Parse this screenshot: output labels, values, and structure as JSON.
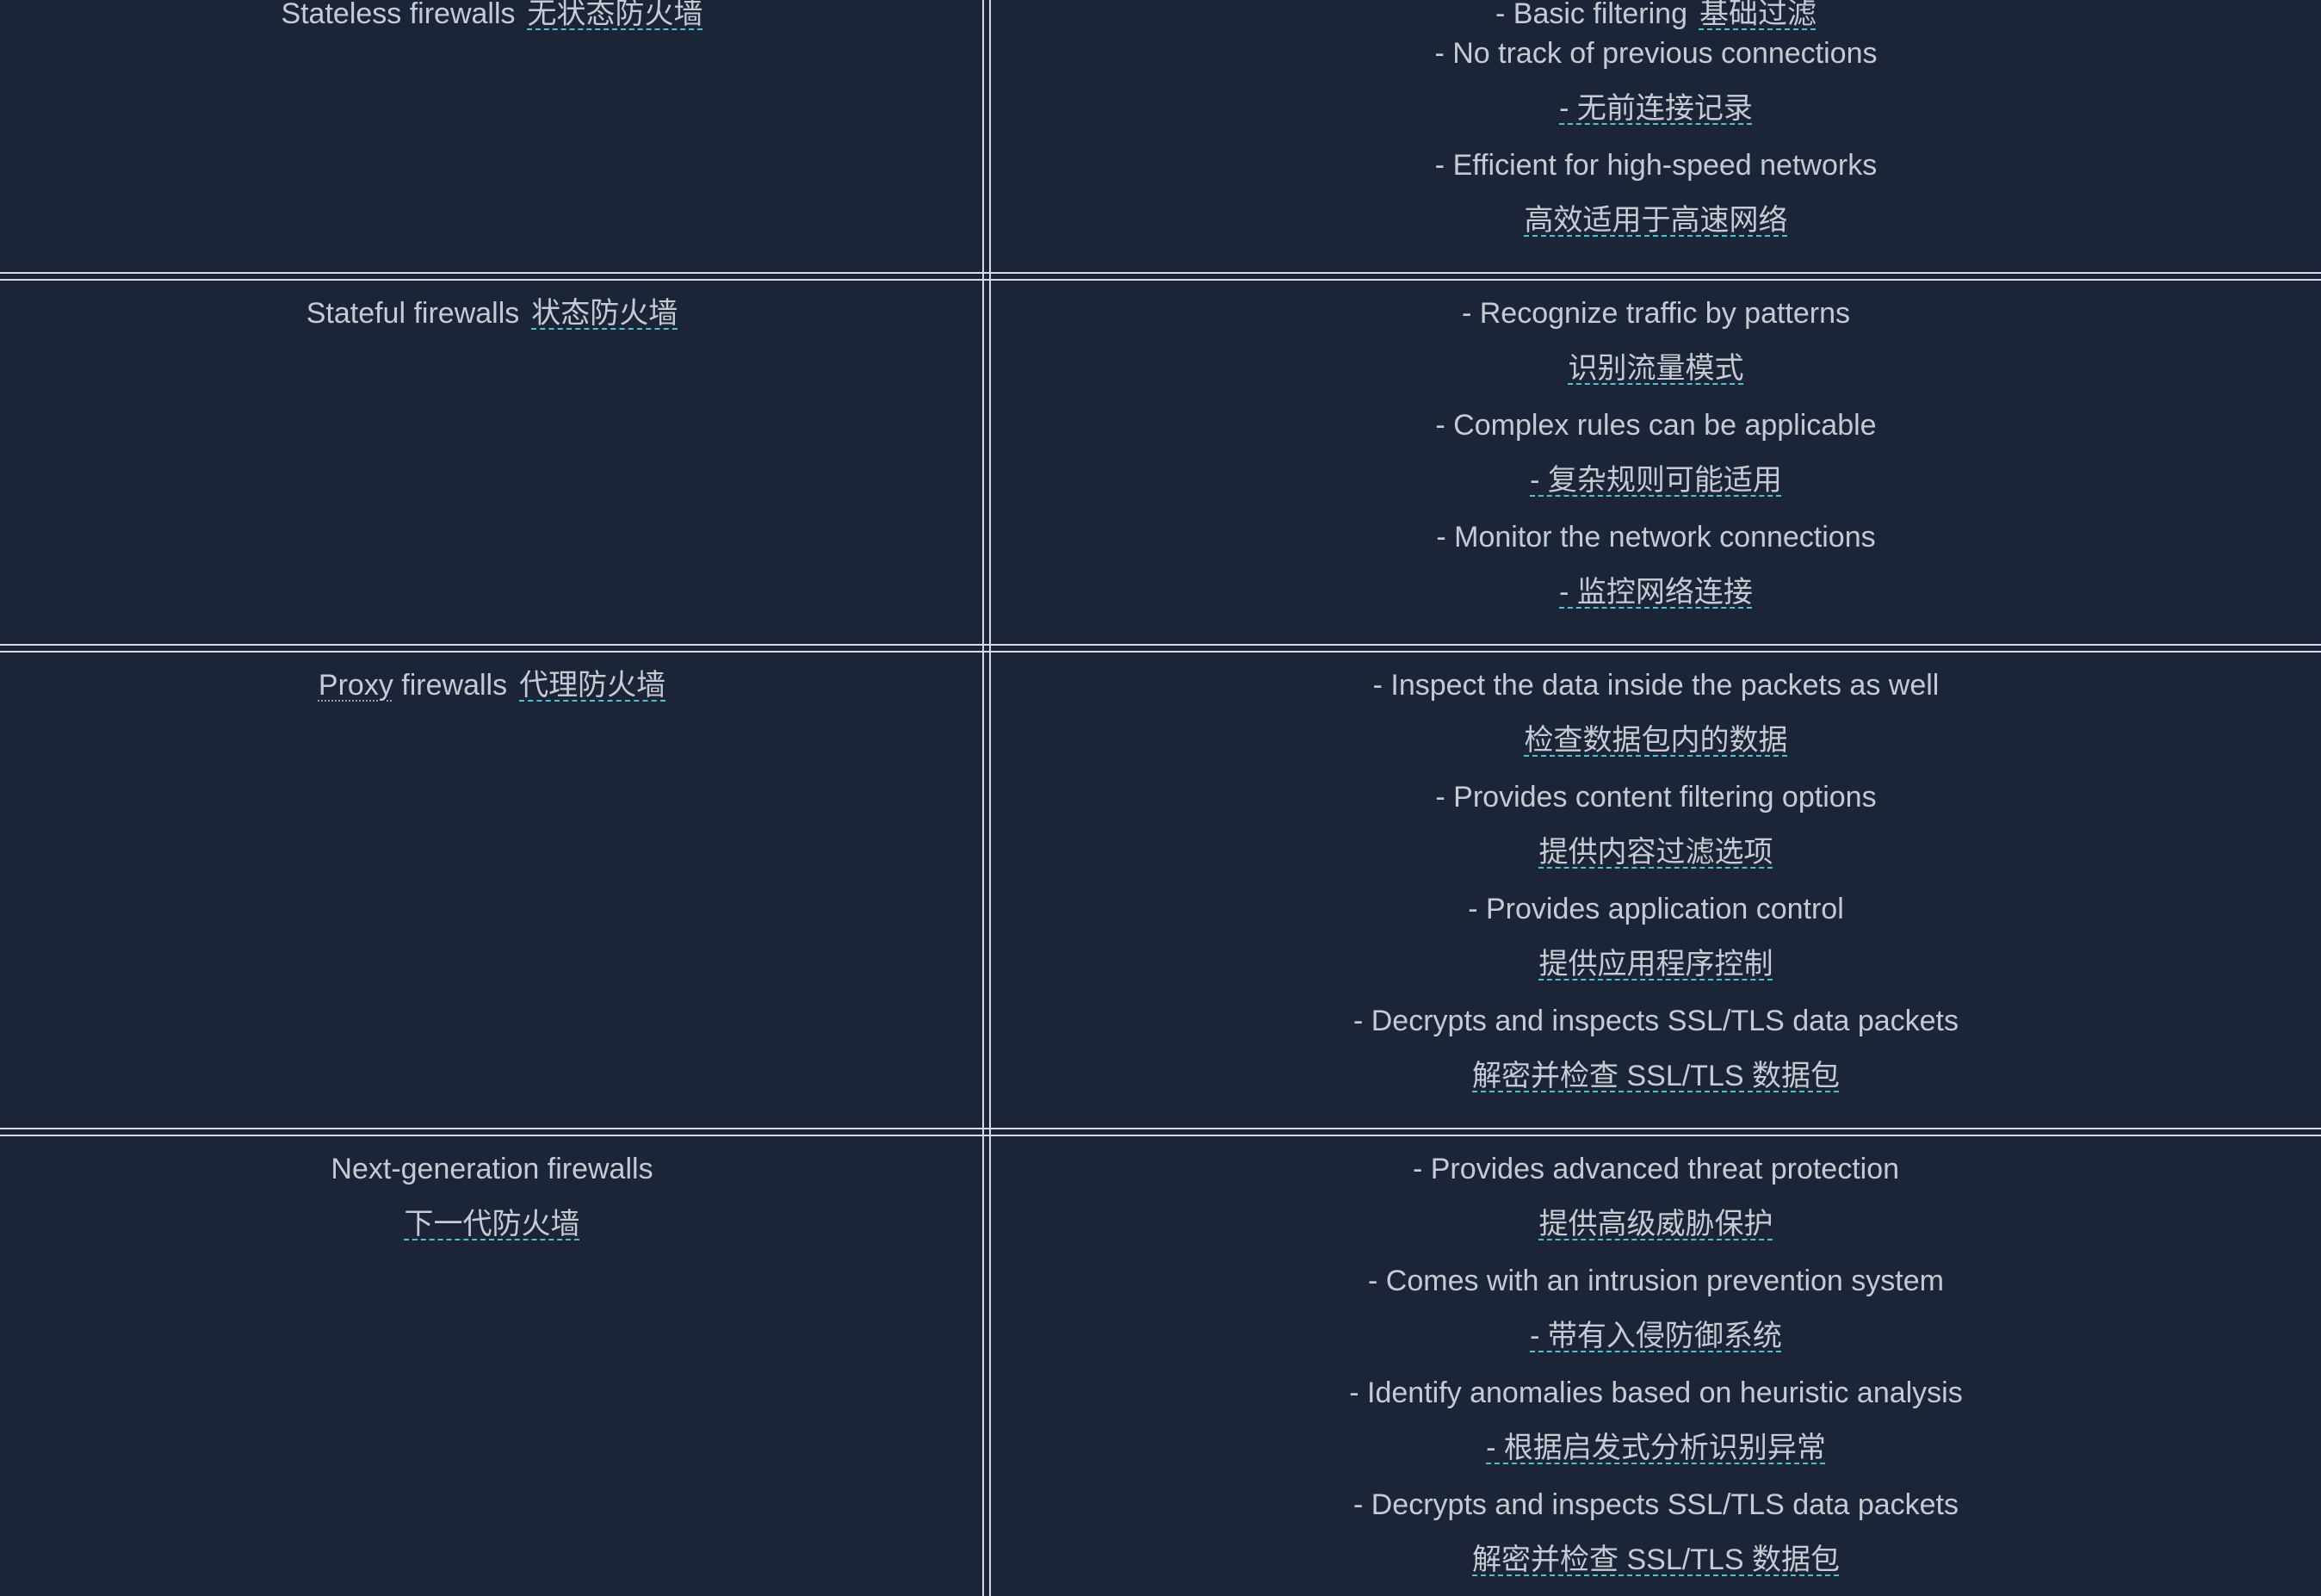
{
  "rows": [
    {
      "name_en": "Stateless firewalls",
      "name_zh": "无状态防火墙",
      "items": [
        {
          "en": "- Basic filtering",
          "zh": "基础过滤"
        },
        {
          "en": "- No track of previous connections",
          "zh": "- 无前连接记录"
        },
        {
          "en": "- Efficient for high-speed networks",
          "zh": "高效适用于高速网络"
        }
      ]
    },
    {
      "name_en": "Stateful firewalls",
      "name_zh": "状态防火墙",
      "items": [
        {
          "en": "- Recognize traffic by patterns",
          "zh": "识别流量模式"
        },
        {
          "en": "- Complex rules can be applicable",
          "zh": "- 复杂规则可能适用"
        },
        {
          "en": "- Monitor the network connections",
          "zh": "- 监控网络连接"
        }
      ]
    },
    {
      "name_en_marked": "Proxy",
      "name_en_rest": "firewalls",
      "name_zh": "代理防火墙",
      "items": [
        {
          "en": "- Inspect the data inside the packets as well",
          "zh": "检查数据包内的数据"
        },
        {
          "en": "- Provides content filtering options",
          "zh": "提供内容过滤选项"
        },
        {
          "en": "- Provides application control",
          "zh": "提供应用程序控制"
        },
        {
          "en": "- Decrypts and inspects SSL/TLS data packets",
          "zh": "解密并检查 SSL/TLS 数据包"
        }
      ]
    },
    {
      "name_en": "Next-generation firewalls",
      "name_zh": "下一代防火墙",
      "items": [
        {
          "en": "- Provides advanced threat protection",
          "zh": "提供高级威胁保护"
        },
        {
          "en": "- Comes with an intrusion prevention system",
          "zh": "- 带有入侵防御系统"
        },
        {
          "en": "- Identify anomalies based on heuristic analysis",
          "zh": "- 根据启发式分析识别异常"
        },
        {
          "en": "- Decrypts and inspects SSL/TLS data packets",
          "zh": "解密并检查 SSL/TLS 数据包"
        }
      ]
    }
  ],
  "colors": {
    "background": "#1c2438",
    "text": "#c6cad2",
    "rule": "#d7dbe3",
    "underline_accent": "#4fc3c9"
  }
}
